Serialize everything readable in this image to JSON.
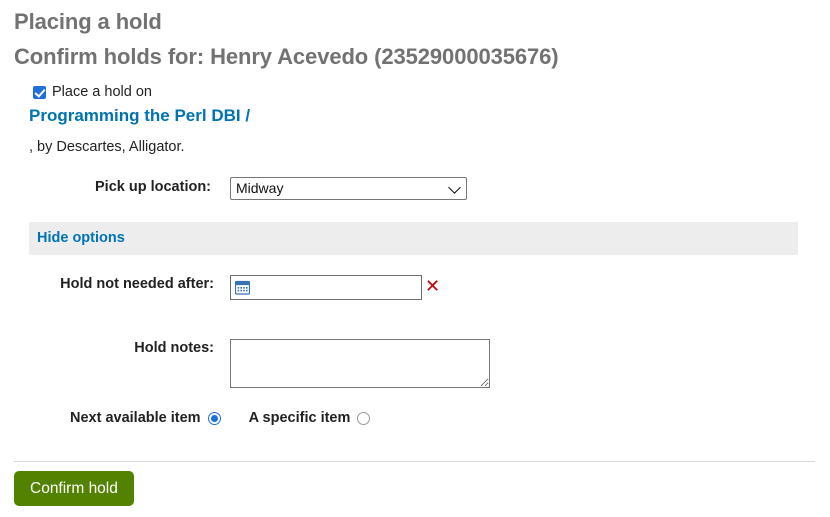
{
  "page": {
    "heading_primary": "Placing a hold",
    "heading_secondary": "Confirm holds for: Henry Acevedo (23529000035676)"
  },
  "hold_item": {
    "checkbox_label": "Place a hold on",
    "checkbox_checked": true,
    "record_title": "Programming the Perl DBI /",
    "record_author": ", by Descartes, Alligator."
  },
  "pickup": {
    "label": "Pick up location:",
    "selected": "Midway",
    "options": [
      "Midway"
    ]
  },
  "options_bar": {
    "toggle_label": "Hide options"
  },
  "expiration": {
    "label": "Hold not needed after:",
    "value": "",
    "placeholder": "",
    "calendar_icon": "calendar-icon",
    "clear_icon": "red-x-clear-icon",
    "clear_glyph": "✕"
  },
  "notes": {
    "label": "Hold notes:",
    "value": "",
    "placeholder": ""
  },
  "item_selection": {
    "next_available_label": "Next available item",
    "next_available_selected": true,
    "specific_item_label": "A specific item",
    "specific_item_selected": false
  },
  "actions": {
    "confirm_label": "Confirm hold"
  },
  "colors": {
    "heading": "#727272",
    "link": "#0073b3",
    "checkbox_blue": "#1e6fd9",
    "radio_blue": "#1e6fd9",
    "clear_red": "#cc0000",
    "button_green": "#538200",
    "options_bar_gray": "#ededed"
  }
}
